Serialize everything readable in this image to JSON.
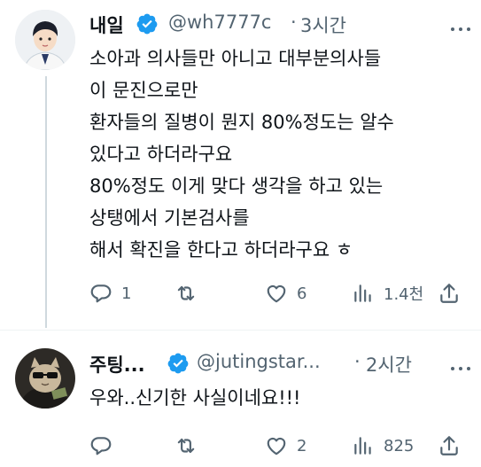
{
  "tweets": [
    {
      "name": "내일",
      "handle": "@wh7777c",
      "separator": "·",
      "time": "3시간",
      "text": "소아과 의사들만 아니고 대부분의사들\n이 문진으로만\n환자들의 질병이 뭔지 80%정도는 알수\n있다고 하더라구요\n80%정도 이게 맞다 생각을 하고 있는\n상탱에서 기본검사를\n해서 확진을 한다고 하더라구요 ㅎ",
      "replies": "1",
      "retweets": "",
      "likes": "6",
      "views": "1.4천"
    },
    {
      "name": "주팅...",
      "handle": "@jutingstar...",
      "separator": "·",
      "time": "2시간",
      "text": "우와..신기한 사실이네요!!!",
      "replies": "",
      "retweets": "",
      "likes": "2",
      "views": "825"
    }
  ],
  "colors": {
    "verified": "#1d9bf0",
    "muted": "#536471",
    "thread_line": "#cfd9de"
  }
}
